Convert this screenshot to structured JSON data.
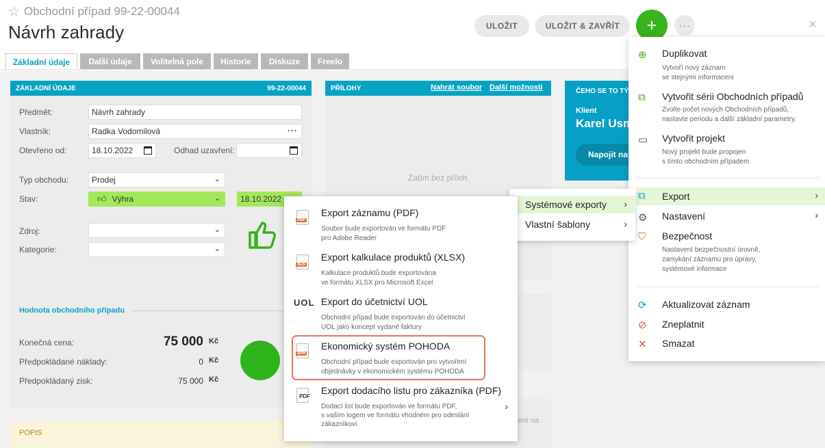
{
  "header": {
    "supertitle": "Obchodní případ 99-22-00044",
    "title": "Návrh zahrady",
    "save_label": "ULOŽIT",
    "save_close_label": "ULOŽIT & ZAVŘÍT",
    "plus_label": "+",
    "more_label": "···",
    "close_label": "×"
  },
  "tabs": [
    "Základní údaje",
    "Další údaje",
    "Volitelná pole",
    "Historie",
    "Diskuze",
    "Freelo"
  ],
  "basic": {
    "heading": "ZÁKLADNÍ ÚDAJE",
    "code": "99-22-00044",
    "subject_label": "Předmět:",
    "subject_value": "Návrh zahrady",
    "owner_label": "Vlastník:",
    "owner_value": "Radka Vodomilová",
    "opened_label": "Otevřeno od:",
    "opened_value": "18.10.2022",
    "close_est_label": "Odhad uzavření:",
    "type_label": "Typ obchodu:",
    "type_value": "Prodej",
    "state_label": "Stav:",
    "state_value": "Výhra",
    "state_date": "18.10.2022",
    "source_label": "Zdroj:",
    "category_label": "Kategorie:",
    "value_heading": "Hodnota obchodního případu",
    "final_price_label": "Konečná cena:",
    "final_price_value": "75 000",
    "costs_label": "Předpokládané náklady:",
    "costs_value": "0",
    "profit_label": "Předpokládaný zisk:",
    "profit_value": "75 000",
    "currency": "Kč"
  },
  "attachments": {
    "heading": "PŘÍLOHY",
    "upload_link": "Nahrát soubor",
    "more_link": "Další možnosti",
    "empty_text": "Zatím bez příloh",
    "partial_text": "eré na"
  },
  "client": {
    "heading": "ČEHO SE TO TÝ",
    "label": "Klient",
    "name": "Karel Usm",
    "connect_button": "Napojit na"
  },
  "popis": {
    "label": "POPIS"
  },
  "menu": {
    "items": [
      {
        "title": "Duplikovat",
        "desc": [
          "Vytvoří nový záznam",
          "se stejnými informaceni"
        ]
      },
      {
        "title": "Vytvořit sérii Obchodních případů",
        "desc": [
          "Zvolte počet nových Obchodních případů,",
          "nastavte periodu a další základní parametry."
        ]
      },
      {
        "title": "Vytvořit projekt",
        "desc": [
          "Nový projekt bude propojen",
          "s tímto obchodním případem"
        ]
      },
      {
        "title": "Export"
      },
      {
        "title": "Nastavení"
      },
      {
        "title": "Bezpečnost",
        "desc": [
          "Nastavení bezpečnostní úrovně,",
          "zamykání záznamu pro úpravy,",
          "systémové informace"
        ]
      },
      {
        "title": "Aktualizovat záznam"
      },
      {
        "title": "Zneplatnit"
      },
      {
        "title": "Smazat"
      }
    ]
  },
  "submenu": {
    "items": [
      "Systémové exporty",
      "Vlastní šablony"
    ]
  },
  "export_menu": {
    "items": [
      {
        "title": "Export záznamu (PDF)",
        "desc": [
          "Soubor bude exportován ve formátu PDF",
          "pro Adobe Reader"
        ],
        "badge": "PDF"
      },
      {
        "title": "Export kalkulace produktů (XLSX)",
        "desc": [
          "Kalkulace produktů bude exportována",
          "ve formátu XLSX pro Microsoft Excel"
        ],
        "badge": "XLS"
      },
      {
        "title": "Export do účetnictví UOL",
        "desc": [
          "Obchodní případ bude exportován do účetnictví",
          "UOL jako koncept vydané faktury"
        ],
        "badge": "UOL"
      },
      {
        "title": "Ekonomický systém POHODA",
        "desc": [
          "Obchodní případ bude exportován pro vytvoření",
          "objednávky v ekonomickém systému POHODA"
        ],
        "badge": "XPH"
      },
      {
        "title": "Export dodacího listu pro zákazníka (PDF)",
        "desc": [
          "Dodací list bude exportován ve formátu PDF,",
          "s vaším logem ve formátu vhodném pro odeslání",
          "zákazníkovi"
        ],
        "badge": "PDF"
      }
    ]
  },
  "colors": {
    "accent": "#06a3c4",
    "green": "#38b21d",
    "win": "#a3e85a",
    "highlight": "#e07757"
  }
}
